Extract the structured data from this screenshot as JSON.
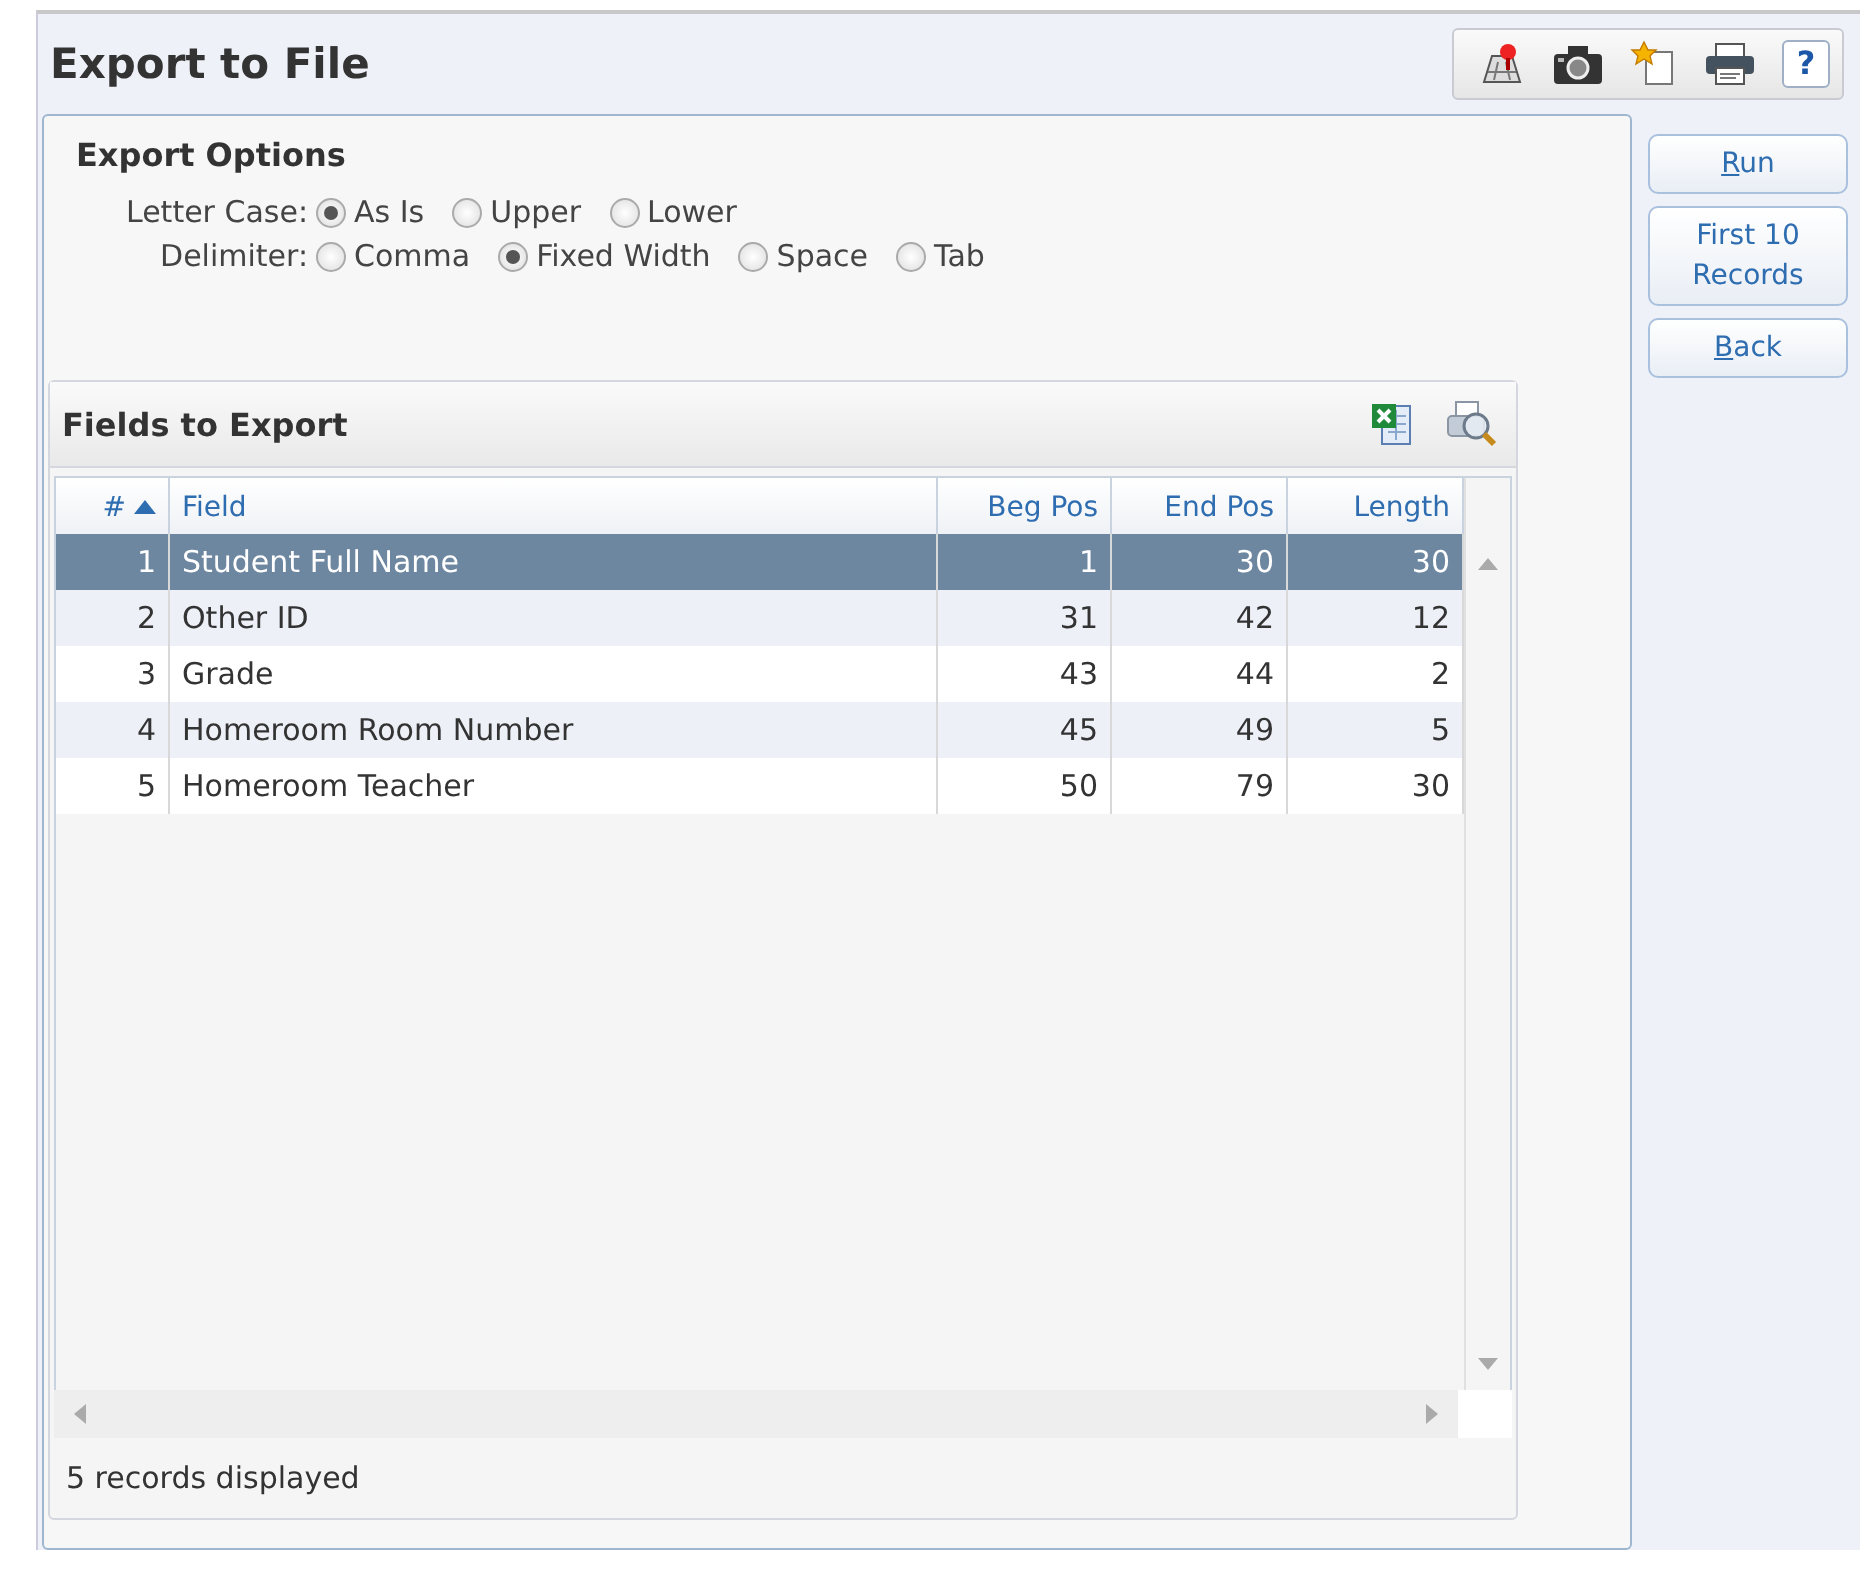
{
  "window": {
    "title": "Export to File"
  },
  "toolbar": [
    {
      "kind": "map"
    },
    {
      "kind": "camera"
    },
    {
      "kind": "new"
    },
    {
      "kind": "print"
    },
    {
      "kind": "help",
      "label": "?"
    }
  ],
  "export_options": {
    "title": "Export Options",
    "groups": [
      {
        "label": "Letter Case:",
        "options": [
          {
            "label": "As Is",
            "selected": true
          },
          {
            "label": "Upper",
            "selected": false
          },
          {
            "label": "Lower",
            "selected": false
          }
        ]
      },
      {
        "label": "Delimiter:",
        "options": [
          {
            "label": "Comma",
            "selected": false
          },
          {
            "label": "Fixed Width",
            "selected": true
          },
          {
            "label": "Space",
            "selected": false
          },
          {
            "label": "Tab",
            "selected": false
          }
        ]
      }
    ]
  },
  "fields_panel": {
    "title": "Fields to Export",
    "tools": [
      {
        "kind": "excel"
      },
      {
        "kind": "preview"
      }
    ],
    "columns": [
      {
        "label": "#",
        "kind": "number",
        "sorted": true
      },
      {
        "label": "Field",
        "kind": "text",
        "sorted": false
      },
      {
        "label": "Beg Pos",
        "kind": "number",
        "sorted": false
      },
      {
        "label": "End Pos",
        "kind": "number",
        "sorted": false
      },
      {
        "label": "Length",
        "kind": "number",
        "sorted": false
      }
    ],
    "rows": [
      {
        "cells": [
          "1",
          "Student Full Name",
          "1",
          "30",
          "30"
        ],
        "selected": true
      },
      {
        "cells": [
          "2",
          "Other ID",
          "31",
          "42",
          "12"
        ],
        "selected": false
      },
      {
        "cells": [
          "3",
          "Grade",
          "43",
          "44",
          "2"
        ],
        "selected": false
      },
      {
        "cells": [
          "4",
          "Homeroom Room Number",
          "45",
          "49",
          "5"
        ],
        "selected": false
      },
      {
        "cells": [
          "5",
          "Homeroom Teacher",
          "50",
          "79",
          "30"
        ],
        "selected": false
      }
    ],
    "status": "5 records displayed"
  },
  "buttons": [
    {
      "label": "Run",
      "mnemonic": true
    },
    {
      "label": "First 10 Records",
      "mnemonic": false
    },
    {
      "label": "Back",
      "mnemonic": true
    }
  ]
}
